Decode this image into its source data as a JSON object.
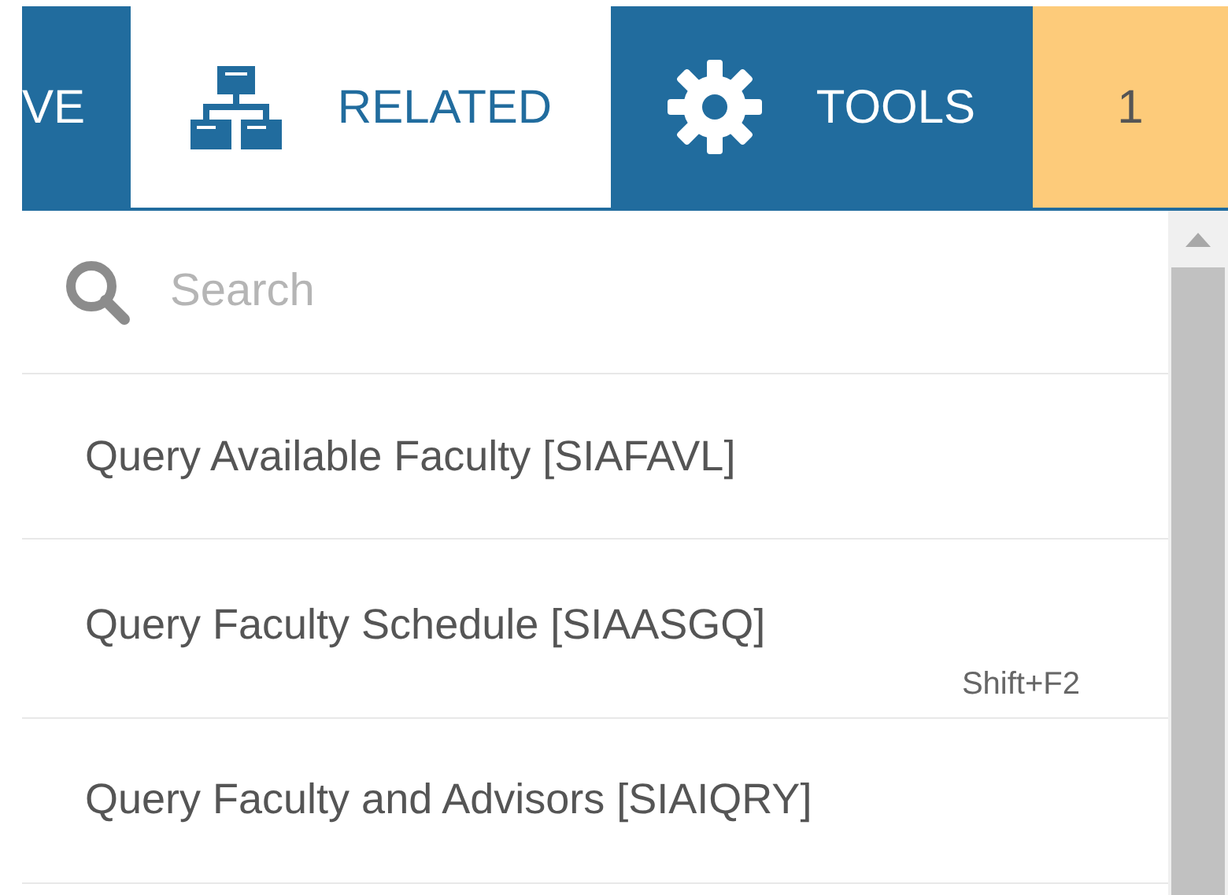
{
  "tabs": [
    {
      "label": "VE",
      "kind": "text",
      "selected": false
    },
    {
      "label": "RELATED",
      "kind": "network",
      "selected": true
    },
    {
      "label": "TOOLS",
      "kind": "gear",
      "selected": false
    },
    {
      "label": "1",
      "kind": "count",
      "selected": false
    }
  ],
  "search": {
    "placeholder": "Search"
  },
  "items": [
    {
      "label": "Query Available Faculty [SIAFAVL]"
    },
    {
      "label": "Query Faculty Schedule [SIAASGQ]",
      "shortcut": "Shift+F2"
    },
    {
      "label": "Query Faculty and Advisors [SIAIQRY]"
    }
  ]
}
